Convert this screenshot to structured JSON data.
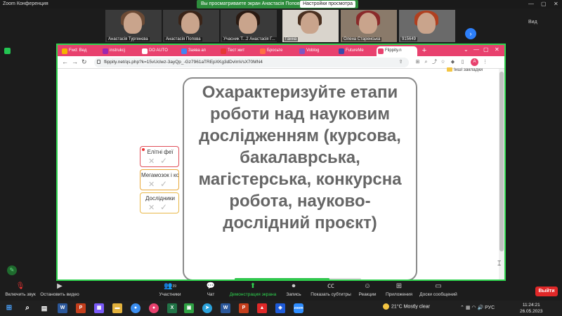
{
  "zoom": {
    "window_title": "Zoom Конференция",
    "share_banner": "Вы просматриваете экран Анастасія Попова",
    "view_options": "Настройки просмотра",
    "view_button": "Вид",
    "participants": [
      {
        "name": "Анастасія Тургенєва"
      },
      {
        "name": "Анастасія Попова"
      },
      {
        "name": "Учасник Т...2 Анастасія Г..."
      },
      {
        "name": "Ганна"
      },
      {
        "name": "Олена Старенська"
      },
      {
        "name": "915649"
      }
    ],
    "toolbar": {
      "mute": "Включить звук",
      "video": "Остановить видео",
      "participants": "Участники",
      "participants_count": "39",
      "chat": "Чат",
      "share": "Демонстрация экрана",
      "record": "Запись",
      "captions": "Показать субтитры",
      "reactions": "Реакции",
      "apps": "Приложения",
      "whiteboard": "Доски сообщений",
      "leave": "Выйти"
    }
  },
  "browser": {
    "tabs": [
      {
        "label": "Fwd: Вед",
        "color": "#f4b400"
      },
      {
        "label": "instrukcj",
        "color": "#9c27b0"
      },
      {
        "label": "DO AUTO",
        "color": "#e8416e"
      },
      {
        "label": "Заява ап",
        "color": "#4285f4"
      },
      {
        "label": "Тест жит",
        "color": "#e53935"
      },
      {
        "label": "Бросьте",
        "color": "#ff7043"
      },
      {
        "label": "Voblog",
        "color": "#7e57c2"
      },
      {
        "label": "FutureMe",
        "color": "#3949ab"
      },
      {
        "label": "Flippity.n",
        "color": "#e8416e",
        "active": true
      }
    ],
    "url": "flippity.net/qs.php?k=15vUclwz-3ayQp_-Gz7961aTREpXKg3dDvlmVsX70MN4",
    "bookmarks": "Інші закладки",
    "profile_initial": "A"
  },
  "quiz": {
    "question": "Охарактеризуйте етапи роботи над науковим дослідженням (курсова, бакалаврська, магістерська, конкурсна робота, науково-дослідний проєкт)",
    "progress": 0.75,
    "players": [
      {
        "name": "Елітні феї",
        "border": "#e0505a"
      },
      {
        "name": "Мегамозок і ко",
        "border": "#e8a83a"
      },
      {
        "name": "Дослідники",
        "border": "#e8b84a"
      }
    ],
    "wrong_symbol": "✕",
    "right_symbol": "✓"
  },
  "windows": {
    "weather_temp": "21°C",
    "weather_text": "Mostly clear",
    "lang": "РУС",
    "time": "11:24:21",
    "date": "26.05.2023"
  }
}
